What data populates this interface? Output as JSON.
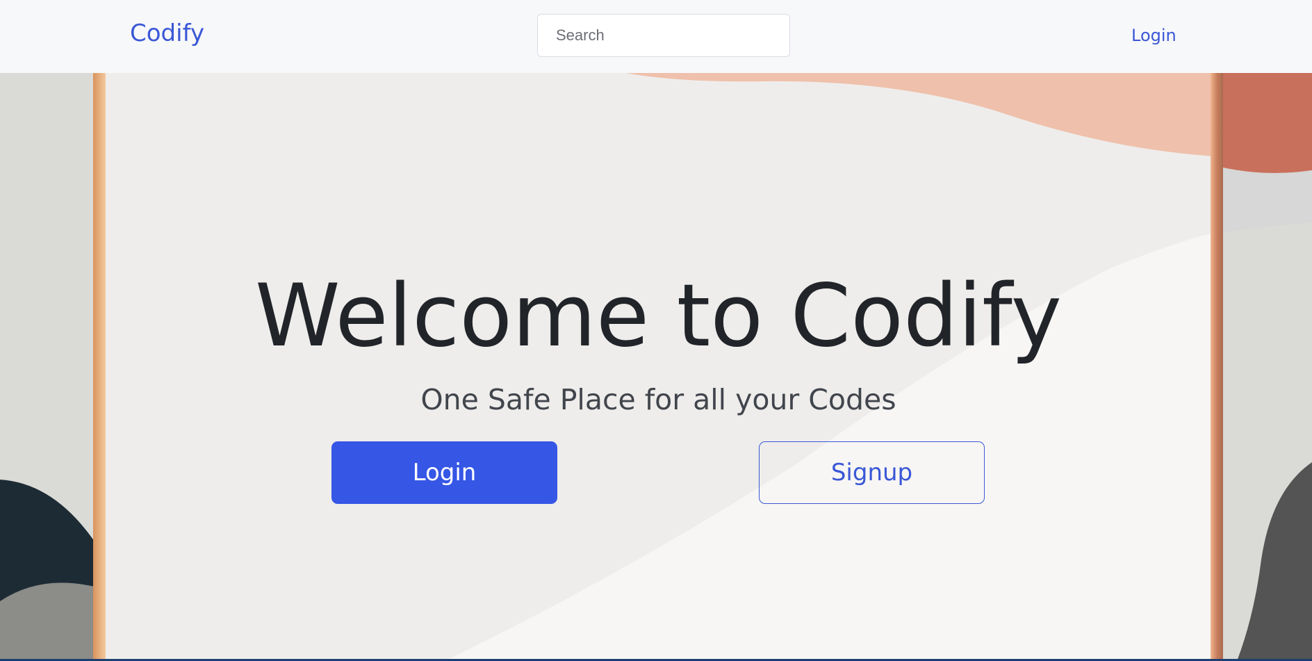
{
  "navbar": {
    "brand": "Codify",
    "search_placeholder": "Search",
    "login_link": "Login"
  },
  "hero": {
    "title": "Welcome to Codify",
    "subtitle": "One Safe Place for all your Codes",
    "login_button": "Login",
    "signup_button": "Signup"
  },
  "colors": {
    "accent": "#3656e6",
    "brand_text": "#3a57d6",
    "title_text": "#212429",
    "navbar_bg": "#f7f8fa"
  }
}
